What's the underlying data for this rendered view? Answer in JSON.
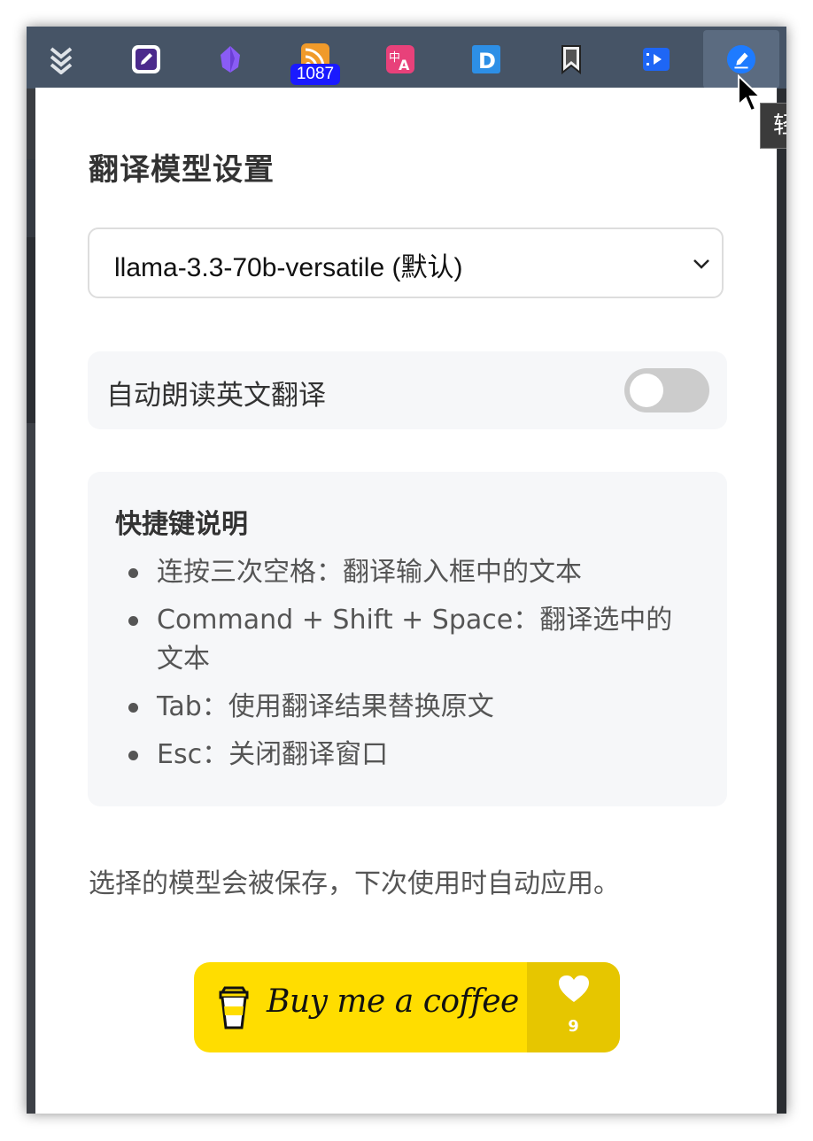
{
  "toolbar": {
    "icons": [
      {
        "name": "chevrons-down-icon"
      },
      {
        "name": "edit-note-icon"
      },
      {
        "name": "obsidian-icon"
      },
      {
        "name": "rss-icon",
        "badge": "1087"
      },
      {
        "name": "translate-icon"
      },
      {
        "name": "dict-d-icon"
      },
      {
        "name": "bookmark-icon"
      },
      {
        "name": "video-icon"
      },
      {
        "name": "pencil-icon",
        "active": true
      }
    ],
    "tooltip_text": "轻"
  },
  "popup": {
    "title": "翻译模型设置",
    "model_select": {
      "value": "llama-3.3-70b-versatile (默认)"
    },
    "auto_read": {
      "label": "自动朗读英文翻译",
      "enabled": false
    },
    "shortcuts": {
      "title": "快捷键说明",
      "items": [
        "连按三次空格：翻译输入框中的文本",
        "Command + Shift + Space：翻译选中的文本",
        "Tab：使用翻译结果替换原文",
        "Esc：关闭翻译窗口"
      ]
    },
    "note": "选择的模型会被保存，下次使用时自动应用。",
    "coffee_button": {
      "label": "Buy me a coffee",
      "count": "9"
    }
  },
  "colors": {
    "toolbar_bg": "#465466",
    "coffee_yellow": "#ffdd00",
    "panel_bg": "#f6f7f9",
    "toggle_off": "#cccccc"
  }
}
